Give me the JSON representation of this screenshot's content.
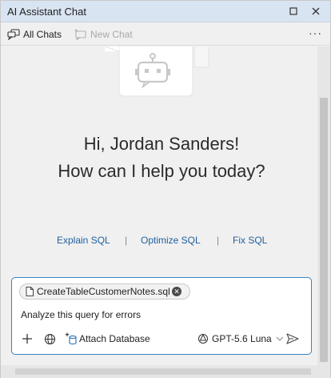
{
  "window": {
    "title": "AI Assistant Chat"
  },
  "titlebar_icons": {
    "maximize": "maximize-icon",
    "close": "close-icon"
  },
  "toolbar": {
    "all_chats_label": "All Chats",
    "new_chat_label": "New Chat",
    "new_chat_disabled": true,
    "more_label": "···"
  },
  "greeting": {
    "line1": "Hi, Jordan Sanders!",
    "line2": "How can I help you today?"
  },
  "suggestions": [
    {
      "label": "Explain SQL"
    },
    {
      "label": "Optimize SQL"
    },
    {
      "label": "Fix SQL"
    }
  ],
  "suggestion_separator": "|",
  "composer": {
    "attachment": {
      "filename": "CreateTableCustomerNotes.sql"
    },
    "prompt_value": "Analyze this query for errors",
    "attach_database_label": "Attach Database",
    "model_label": "GPT-5.6 Luna"
  },
  "colors": {
    "accent": "#3b82c4",
    "link": "#1f5f9e",
    "titlebar_bg": "#d9e4f2"
  }
}
